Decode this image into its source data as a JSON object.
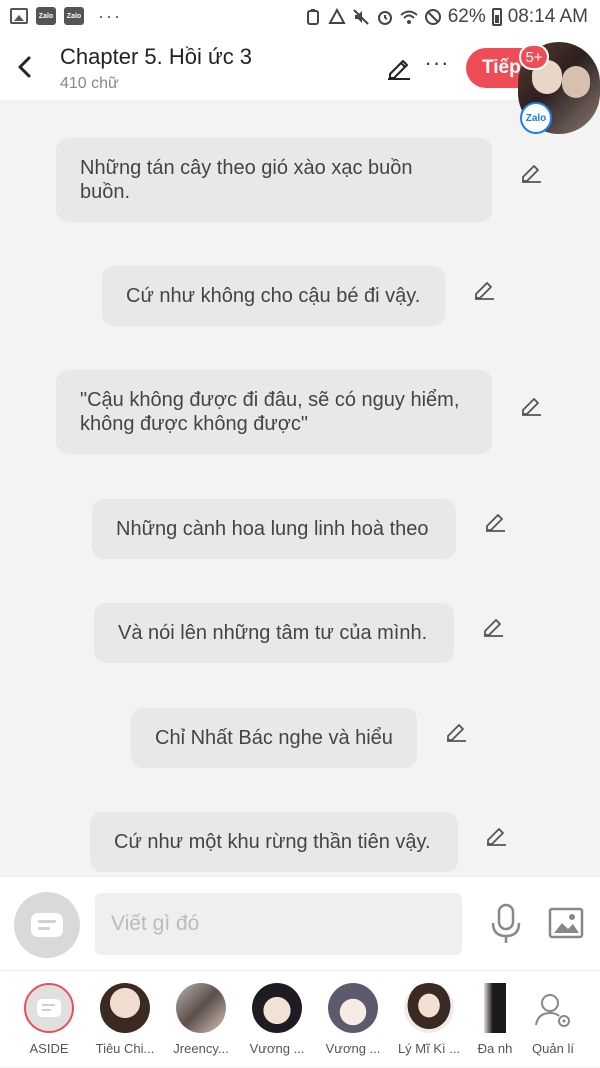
{
  "status_bar": {
    "battery": "62%",
    "time": "08:14 AM",
    "app_icons": [
      "gallery-icon",
      "zalo-icon",
      "zalo-icon"
    ],
    "system_icons": [
      "vpn-icon",
      "data-saver-icon",
      "mute-icon",
      "alarm-icon",
      "wifi-icon",
      "dnd-icon",
      "battery-icon"
    ]
  },
  "header": {
    "title": "Chapter 5. Hồi ức 3",
    "word_count": "410 chữ",
    "next_label": "Tiếp"
  },
  "chathead": {
    "badge": "5+",
    "app": "Zalo"
  },
  "messages": [
    {
      "text": "Những tán cây theo gió xào xạc buồn\nbuồn."
    },
    {
      "text": "Cứ như không cho cậu bé đi vậy."
    },
    {
      "text": "\"Cậu không được đi đâu, sẽ có nguy hiểm,\nkhông được không được\""
    },
    {
      "text": "Những cành hoa lung linh hoà theo"
    },
    {
      "text": "Và nói lên những tâm tư của mình."
    },
    {
      "text": "Chỉ Nhất Bác nghe và hiểu"
    },
    {
      "text": "Cứ như một khu rừng thần tiên vậy."
    }
  ],
  "composer": {
    "placeholder": "Viết gì đó"
  },
  "characters": [
    {
      "label": "ASIDE",
      "color": "#e0e0e0"
    },
    {
      "label": "Tiêu Chi...",
      "color": "#6b5a4f"
    },
    {
      "label": "Jreency...",
      "color": "#8b8b95"
    },
    {
      "label": "Vương ...",
      "color": "#3d3a3a"
    },
    {
      "label": "Vương ...",
      "color": "#7a7a88"
    },
    {
      "label": "Lý Mĩ Kì ...",
      "color": "#c8b4a4"
    },
    {
      "label": "Đa nh",
      "color": "#2a2a2a"
    },
    {
      "label": "Quản lí",
      "color": "#ffffff"
    }
  ]
}
